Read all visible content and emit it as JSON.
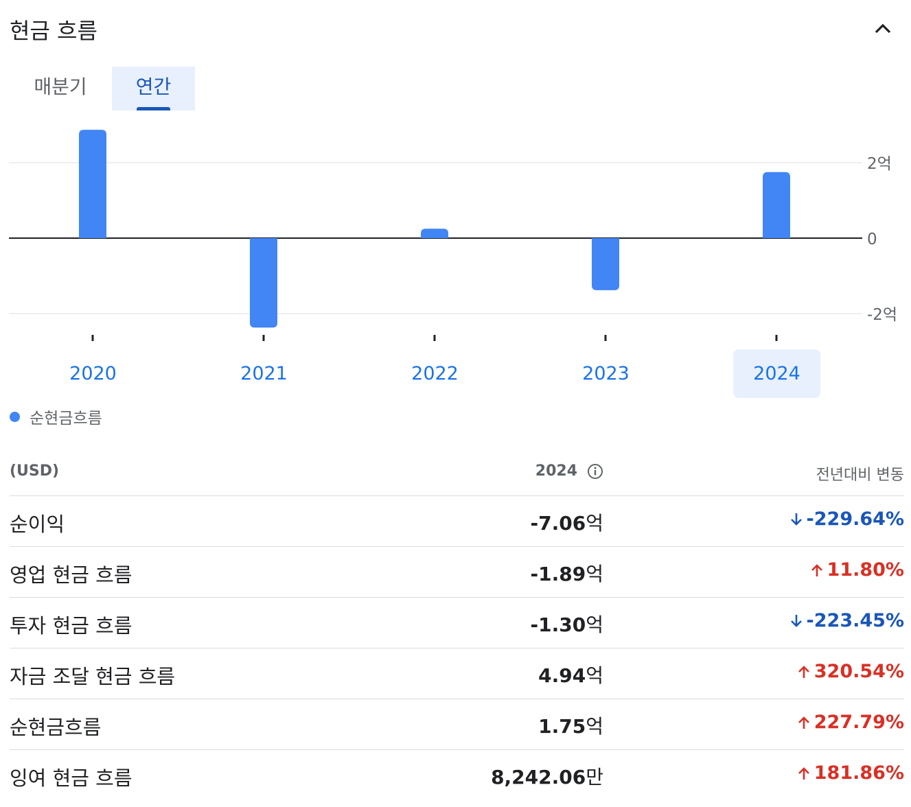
{
  "header": {
    "title": "현금 흐름"
  },
  "tabs": [
    {
      "label": "매분기",
      "selected": false
    },
    {
      "label": "연간",
      "selected": true
    }
  ],
  "colors": {
    "bar": "#4285f4",
    "accent": "#1a73e8",
    "down": "#1a57b8",
    "up": "#d93025"
  },
  "chart_data": {
    "type": "bar",
    "categories": [
      "2020",
      "2021",
      "2022",
      "2023",
      "2024"
    ],
    "series": [
      {
        "name": "순현금흐름",
        "values": [
          2.87,
          -2.37,
          0.25,
          -1.38,
          1.75
        ]
      }
    ],
    "unit": "억",
    "ylim": [
      -2.9,
      3.2
    ],
    "yticks": [
      {
        "value": 2,
        "label": "2억"
      },
      {
        "value": 0,
        "label": "0"
      },
      {
        "value": -2,
        "label": "-2억"
      }
    ],
    "selected_category": "2024",
    "grid": true,
    "legend_position": "bottom-left"
  },
  "legend": {
    "label": "순현금흐름"
  },
  "table": {
    "unit_header": "(USD)",
    "year_header": "2024",
    "change_header": "전년대비 변동",
    "rows": [
      {
        "label": "순이익",
        "value": "-7.06",
        "unit": "억",
        "change": "-229.64%",
        "direction": "down"
      },
      {
        "label": "영업 현금 흐름",
        "value": "-1.89",
        "unit": "억",
        "change": "11.80%",
        "direction": "up"
      },
      {
        "label": "투자 현금 흐름",
        "value": "-1.30",
        "unit": "억",
        "change": "-223.45%",
        "direction": "down"
      },
      {
        "label": "자금 조달 현금 흐름",
        "value": "4.94",
        "unit": "억",
        "change": "320.54%",
        "direction": "up"
      },
      {
        "label": "순현금흐름",
        "value": "1.75",
        "unit": "억",
        "change": "227.79%",
        "direction": "up"
      },
      {
        "label": "잉여 현금 흐름",
        "value": "8,242.06",
        "unit": "만",
        "change": "181.86%",
        "direction": "up"
      }
    ]
  }
}
